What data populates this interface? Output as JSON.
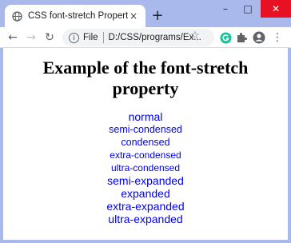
{
  "browser": {
    "tab": {
      "title": "CSS font-stretch Property",
      "close": "×"
    },
    "new_tab": "+",
    "window_controls": {
      "minimize": "–",
      "maximize": "□",
      "close": "✕"
    },
    "nav": {
      "back": "←",
      "forward": "→",
      "reload": "↻"
    },
    "address": {
      "scheme": "File",
      "url": "D:/CSS/programs/Ex..."
    },
    "icons": {
      "favicon": "globe-icon",
      "info": "info-icon",
      "star": "star-icon",
      "grammarly": "grammarly-icon",
      "extensions": "puzzle-icon",
      "profile": "profile-icon",
      "menu": "kebab-menu-icon"
    },
    "colors": {
      "frame": "#a9b9ec",
      "close_hover": "#e81123",
      "grammarly": "#15c39a"
    }
  },
  "page": {
    "heading": "Example of the font-stretch property",
    "items": [
      "normal",
      "semi-condensed",
      "condensed",
      "extra-condensed",
      "ultra-condensed",
      "semi-expanded",
      "expanded",
      "extra-expanded",
      "ultra-expanded"
    ],
    "text_color": "#0000ee"
  }
}
